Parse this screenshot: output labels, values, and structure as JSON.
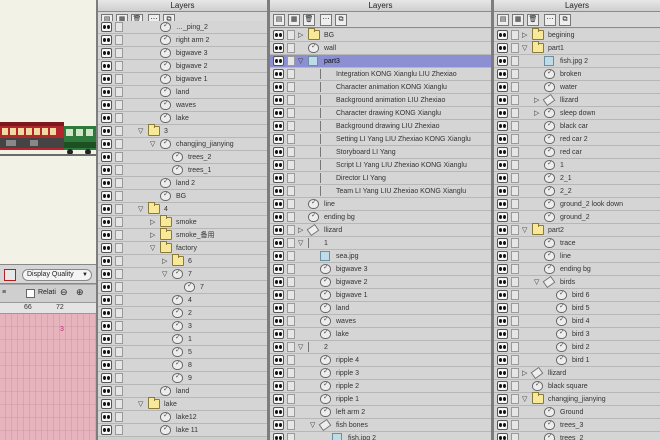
{
  "toolbar": {
    "display_quality_label": "Display Quality",
    "relative_label": "Relati",
    "ruler_numbers": [
      "66",
      "72"
    ],
    "timeline_marker": "3"
  },
  "panels": [
    {
      "title": "Layers",
      "rows": [
        {
          "depth": 2,
          "twisty": "",
          "icon": "shape",
          "label": "…_ping_2"
        },
        {
          "depth": 2,
          "twisty": "",
          "icon": "shape",
          "label": "right arm 2"
        },
        {
          "depth": 2,
          "twisty": "",
          "icon": "shape",
          "label": "bigwave 3"
        },
        {
          "depth": 2,
          "twisty": "",
          "icon": "shape",
          "label": "bigwave 2"
        },
        {
          "depth": 2,
          "twisty": "",
          "icon": "shape",
          "label": "bigwave 1"
        },
        {
          "depth": 2,
          "twisty": "",
          "icon": "shape",
          "label": "land"
        },
        {
          "depth": 2,
          "twisty": "",
          "icon": "shape",
          "label": "waves"
        },
        {
          "depth": 2,
          "twisty": "",
          "icon": "shape",
          "label": "lake"
        },
        {
          "depth": 1,
          "twisty": "▽",
          "icon": "folder",
          "label": "3"
        },
        {
          "depth": 2,
          "twisty": "▽",
          "icon": "shape",
          "label": "changjing_jianying"
        },
        {
          "depth": 3,
          "twisty": "",
          "icon": "shape",
          "label": "trees_2"
        },
        {
          "depth": 3,
          "twisty": "",
          "icon": "shape",
          "label": "trees_1"
        },
        {
          "depth": 2,
          "twisty": "",
          "icon": "shape",
          "label": "land 2"
        },
        {
          "depth": 2,
          "twisty": "",
          "icon": "shape",
          "label": "BG"
        },
        {
          "depth": 1,
          "twisty": "▽",
          "icon": "folder",
          "label": "4"
        },
        {
          "depth": 2,
          "twisty": "▷",
          "icon": "folder",
          "label": "smoke"
        },
        {
          "depth": 2,
          "twisty": "▷",
          "icon": "folder",
          "label": "smoke_备用"
        },
        {
          "depth": 2,
          "twisty": "▽",
          "icon": "folder",
          "label": "factory"
        },
        {
          "depth": 3,
          "twisty": "▷",
          "icon": "folder",
          "label": "6"
        },
        {
          "depth": 3,
          "twisty": "▽",
          "icon": "shape",
          "label": "7"
        },
        {
          "depth": 4,
          "twisty": "",
          "icon": "shape",
          "label": "7"
        },
        {
          "depth": 3,
          "twisty": "",
          "icon": "shape",
          "label": "4"
        },
        {
          "depth": 3,
          "twisty": "",
          "icon": "shape",
          "label": "2"
        },
        {
          "depth": 3,
          "twisty": "",
          "icon": "shape",
          "label": "3"
        },
        {
          "depth": 3,
          "twisty": "",
          "icon": "shape",
          "label": "1"
        },
        {
          "depth": 3,
          "twisty": "",
          "icon": "shape",
          "label": "5"
        },
        {
          "depth": 3,
          "twisty": "",
          "icon": "shape",
          "label": "8"
        },
        {
          "depth": 3,
          "twisty": "",
          "icon": "shape",
          "label": "9"
        },
        {
          "depth": 2,
          "twisty": "",
          "icon": "shape",
          "label": "land"
        },
        {
          "depth": 1,
          "twisty": "▽",
          "icon": "folder",
          "label": "lake"
        },
        {
          "depth": 2,
          "twisty": "",
          "icon": "shape",
          "label": "lake12"
        },
        {
          "depth": 2,
          "twisty": "",
          "icon": "shape",
          "label": "lake 11"
        }
      ]
    },
    {
      "title": "Layers",
      "rows": [
        {
          "depth": 0,
          "twisty": "▷",
          "icon": "folder",
          "label": "BG"
        },
        {
          "depth": 0,
          "twisty": "",
          "icon": "shape",
          "label": "wall"
        },
        {
          "depth": 0,
          "twisty": "▽",
          "icon": "image",
          "label": "part3",
          "selected": true
        },
        {
          "depth": 1,
          "twisty": "",
          "icon": "text",
          "label": "Integration  KONG Xianglu     LIU Zhexiao"
        },
        {
          "depth": 1,
          "twisty": "",
          "icon": "text",
          "label": "Character animation  KONG Xianglu"
        },
        {
          "depth": 1,
          "twisty": "",
          "icon": "text",
          "label": "Background animation  LIU Zhexiao"
        },
        {
          "depth": 1,
          "twisty": "",
          "icon": "text",
          "label": "Character drawing  KONG Xianglu"
        },
        {
          "depth": 1,
          "twisty": "",
          "icon": "text",
          "label": "Background drawing  LIU Zhexiao"
        },
        {
          "depth": 1,
          "twisty": "",
          "icon": "text",
          "label": "Setting  LI Yang      LIU Zhexiao      KONG Xianglu"
        },
        {
          "depth": 1,
          "twisty": "",
          "icon": "text",
          "label": "Storyboard  LI Yang"
        },
        {
          "depth": 1,
          "twisty": "",
          "icon": "text",
          "label": "Script  LI Yang      LIU Zhexiao      KONG Xianglu"
        },
        {
          "depth": 1,
          "twisty": "",
          "icon": "text",
          "label": "Director  LI Yang"
        },
        {
          "depth": 1,
          "twisty": "",
          "icon": "text",
          "label": "Team  LI Yang      LIU Zhexiao      KONG Xianglu"
        },
        {
          "depth": 0,
          "twisty": "",
          "icon": "shape",
          "label": "line"
        },
        {
          "depth": 0,
          "twisty": "",
          "icon": "shape",
          "label": "ending bg"
        },
        {
          "depth": 0,
          "twisty": "▷",
          "icon": "bone",
          "label": "llizard"
        },
        {
          "depth": 0,
          "twisty": "▽",
          "icon": "text",
          "label": "1"
        },
        {
          "depth": 1,
          "twisty": "",
          "icon": "image",
          "label": "sea.jpg"
        },
        {
          "depth": 1,
          "twisty": "",
          "icon": "shape",
          "label": "bigwave 3"
        },
        {
          "depth": 1,
          "twisty": "",
          "icon": "shape",
          "label": "bigwave 2"
        },
        {
          "depth": 1,
          "twisty": "",
          "icon": "shape",
          "label": "bigwave 1"
        },
        {
          "depth": 1,
          "twisty": "",
          "icon": "shape",
          "label": "land"
        },
        {
          "depth": 1,
          "twisty": "",
          "icon": "shape",
          "label": "waves"
        },
        {
          "depth": 1,
          "twisty": "",
          "icon": "shape",
          "label": "lake"
        },
        {
          "depth": 0,
          "twisty": "▽",
          "icon": "text",
          "label": "2"
        },
        {
          "depth": 1,
          "twisty": "",
          "icon": "shape",
          "label": "ripple 4"
        },
        {
          "depth": 1,
          "twisty": "",
          "icon": "shape",
          "label": "ripple 3"
        },
        {
          "depth": 1,
          "twisty": "",
          "icon": "shape",
          "label": "ripple 2"
        },
        {
          "depth": 1,
          "twisty": "",
          "icon": "shape",
          "label": "ripple 1"
        },
        {
          "depth": 1,
          "twisty": "",
          "icon": "shape",
          "label": "left arm 2"
        },
        {
          "depth": 1,
          "twisty": "▽",
          "icon": "bone",
          "label": "fish bones"
        },
        {
          "depth": 2,
          "twisty": "",
          "icon": "image",
          "label": "fish.jpg 2"
        }
      ]
    },
    {
      "title": "Layers",
      "rows": [
        {
          "depth": 0,
          "twisty": "▷",
          "icon": "folder",
          "label": "begining"
        },
        {
          "depth": 0,
          "twisty": "▽",
          "icon": "folder",
          "label": "part1"
        },
        {
          "depth": 1,
          "twisty": "",
          "icon": "image",
          "label": "fish.jpg 2"
        },
        {
          "depth": 1,
          "twisty": "",
          "icon": "shape",
          "label": "broken"
        },
        {
          "depth": 1,
          "twisty": "",
          "icon": "shape",
          "label": "water"
        },
        {
          "depth": 1,
          "twisty": "▷",
          "icon": "bone",
          "label": "llizard"
        },
        {
          "depth": 1,
          "twisty": "▷",
          "icon": "shape",
          "label": "sleep down"
        },
        {
          "depth": 1,
          "twisty": "",
          "icon": "shape",
          "label": "black car"
        },
        {
          "depth": 1,
          "twisty": "",
          "icon": "shape",
          "label": "red car 2"
        },
        {
          "depth": 1,
          "twisty": "",
          "icon": "shape",
          "label": "red car"
        },
        {
          "depth": 1,
          "twisty": "",
          "icon": "shape",
          "label": "1"
        },
        {
          "depth": 1,
          "twisty": "",
          "icon": "shape",
          "label": "2_1"
        },
        {
          "depth": 1,
          "twisty": "",
          "icon": "shape",
          "label": "2_2"
        },
        {
          "depth": 1,
          "twisty": "",
          "icon": "shape",
          "label": "ground_2 look down"
        },
        {
          "depth": 1,
          "twisty": "",
          "icon": "shape",
          "label": "ground_2"
        },
        {
          "depth": 0,
          "twisty": "▽",
          "icon": "folder",
          "label": "part2"
        },
        {
          "depth": 1,
          "twisty": "",
          "icon": "shape",
          "label": "trace"
        },
        {
          "depth": 1,
          "twisty": "",
          "icon": "shape",
          "label": "line"
        },
        {
          "depth": 1,
          "twisty": "",
          "icon": "shape",
          "label": "ending bg"
        },
        {
          "depth": 1,
          "twisty": "▽",
          "icon": "bone",
          "label": "birds"
        },
        {
          "depth": 2,
          "twisty": "",
          "icon": "shape",
          "label": "bird 6"
        },
        {
          "depth": 2,
          "twisty": "",
          "icon": "shape",
          "label": "bird 5"
        },
        {
          "depth": 2,
          "twisty": "",
          "icon": "shape",
          "label": "bird 4"
        },
        {
          "depth": 2,
          "twisty": "",
          "icon": "shape",
          "label": "bird 3"
        },
        {
          "depth": 2,
          "twisty": "",
          "icon": "shape",
          "label": "bird 2"
        },
        {
          "depth": 2,
          "twisty": "",
          "icon": "shape",
          "label": "bird 1"
        },
        {
          "depth": 0,
          "twisty": "▷",
          "icon": "bone",
          "label": "llizard"
        },
        {
          "depth": 0,
          "twisty": "",
          "icon": "shape",
          "label": "black square"
        },
        {
          "depth": 0,
          "twisty": "▽",
          "icon": "folder",
          "label": "changjing_jianying"
        },
        {
          "depth": 1,
          "twisty": "",
          "icon": "shape",
          "label": "Ground"
        },
        {
          "depth": 1,
          "twisty": "",
          "icon": "shape",
          "label": "trees_3"
        },
        {
          "depth": 1,
          "twisty": "",
          "icon": "shape",
          "label": "trees_2"
        }
      ]
    }
  ],
  "colors": {
    "selection": "#8c8fd2",
    "folder": "#f8e89a",
    "timeline": "#e7b3bd"
  }
}
